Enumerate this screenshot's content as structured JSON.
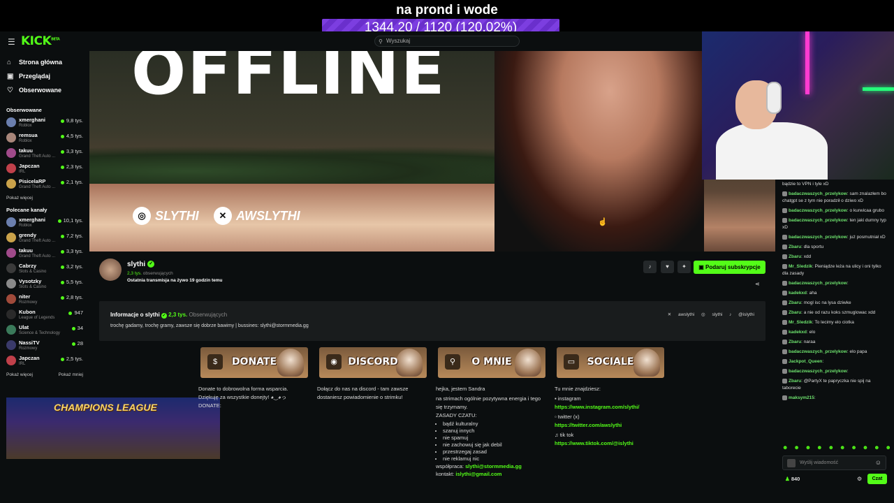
{
  "overlay": {
    "title": "na prond i wode",
    "goal": "1344.20 / 1120 (120.02%)",
    "goal_progress": 1.2002
  },
  "header": {
    "logo": "KICK",
    "logo_beta": "BETA",
    "search_placeholder": "Wyszukaj"
  },
  "nav": [
    {
      "label": "Strona główna",
      "icon": "home-icon",
      "glyph": "⌂"
    },
    {
      "label": "Przeglądaj",
      "icon": "browse-icon",
      "glyph": "▣"
    },
    {
      "label": "Obserwowane",
      "icon": "heart-icon",
      "glyph": "♡"
    }
  ],
  "followed": {
    "title": "Obserwowane",
    "channels": [
      {
        "name": "xmerghani",
        "category": "Roblox",
        "viewers": "9,8 tys.",
        "color": "#6b7fae"
      },
      {
        "name": "remsua",
        "category": "Roblox",
        "viewers": "4,5 tys.",
        "color": "#a8867a"
      },
      {
        "name": "takuu",
        "category": "Grand Theft Auto ...",
        "viewers": "3,3 tys.",
        "color": "#a04a8a"
      },
      {
        "name": "Japczan",
        "category": "IRL",
        "viewers": "2,3 tys.",
        "color": "#c0404a"
      },
      {
        "name": "PisicelaRP",
        "category": "Grand Theft Auto ...",
        "viewers": "2,1 tys.",
        "color": "#caa24a"
      }
    ],
    "more": "Pokaż więcej"
  },
  "recommended": {
    "title": "Polecane kanały",
    "channels": [
      {
        "name": "xmerghani",
        "category": "Roblox",
        "viewers": "10,1 tys.",
        "color": "#6b7fae"
      },
      {
        "name": "grendy",
        "category": "Grand Theft Auto ...",
        "viewers": "7,2 tys.",
        "color": "#caa24a"
      },
      {
        "name": "takuu",
        "category": "Grand Theft Auto ...",
        "viewers": "3,3 tys.",
        "color": "#a04a8a"
      },
      {
        "name": "Cabrzy",
        "category": "Slots & Casino",
        "viewers": "3,2 tys.",
        "color": "#3a3a3a"
      },
      {
        "name": "Vysotzky",
        "category": "Slots & Casino",
        "viewers": "5,5 tys.",
        "color": "#8a8a8a"
      },
      {
        "name": "niter",
        "category": "Rozmowy",
        "viewers": "2,8 tys.",
        "color": "#a04a3a"
      },
      {
        "name": "Kubon",
        "category": "League of Legends",
        "viewers": "947",
        "color": "#2a2a2a"
      },
      {
        "name": "Ulat",
        "category": "Science & Technology",
        "viewers": "34",
        "color": "#3a7a5a"
      },
      {
        "name": "NassiTV",
        "category": "Rozmowy",
        "viewers": "28",
        "color": "#3a3a6a"
      },
      {
        "name": "Japczan",
        "category": "IRL",
        "viewers": "2,5 tys.",
        "color": "#c0404a"
      }
    ],
    "more": "Pokaż więcej",
    "less": "Pokaż mniej"
  },
  "promo": {
    "title": "CHAMPIONS LEAGUE"
  },
  "banner": {
    "offline": "OFFLINE",
    "instagram": "SLYTHI",
    "twitter": "AWSLYTHI"
  },
  "channel": {
    "name": "slythi",
    "followers": "2,3 tys.",
    "followers_label": "obserwujących",
    "last_stream": "Ostatnia transmisja na żywo 19 godzin temu",
    "gift_label": "Podaruj subskrypcje"
  },
  "about": {
    "title": "Informacje o slythi",
    "followers": "2,3 tys.",
    "followers_label": "Obserwujących",
    "description": "trochę gadamy, trochę gramy, zawsze się dobrze bawimy | bussines: slythi@stormmedia.gg",
    "links": [
      "awslythi",
      "slythi",
      "@islythi"
    ]
  },
  "panels": [
    {
      "label": "DONATE",
      "glyph": "$"
    },
    {
      "label": "DISCORD",
      "glyph": "◉"
    },
    {
      "label": "O MNIE",
      "glyph": "⚲"
    },
    {
      "label": "SOCIALE",
      "glyph": "▭"
    }
  ],
  "panel_texts": {
    "donate": [
      "Donate to dobrowolna forma wsparcia.",
      "Dziękuję za wszystkie donejty! ◕‿◕っ",
      "DONATE:"
    ],
    "discord": "Dołącz do nas na discord - tam zawsze dostaniesz powiadomienie o strimku!",
    "about_intro": "hejka, jestem Sandra",
    "about_body": "na strimach ogólnie pozytywna energia i tego się trzymamy.",
    "rules_title": "ZASADY CZATU:",
    "rules": [
      "bądź kulturalny",
      "szanuj innych",
      "nie spamuj",
      "nie zachowuj się jak debil",
      "przestrzegaj zasad",
      "nie reklamuj nic"
    ],
    "collab_label": "współpraca:",
    "collab_email": "slythi@stormmedia.gg",
    "contact_label": "kontakt:",
    "contact_email": "islythi@gmail.com",
    "socials_title": "Tu mnie znajdziesz:",
    "ig_label": "instagram",
    "ig_url": "https://www.instagram.com/slythi/",
    "tw_label": "twitter (x)",
    "tw_url": "https://twitter.com/awslythi",
    "tt_label": "tik tok",
    "tt_url": "https://www.tiktok.com/@islythi"
  },
  "chat": {
    "messages": [
      {
        "user": "",
        "text": "bądzie to VPN i tyle xD"
      },
      {
        "user": "badaczwaszych_przelykow",
        "text": "sam znalazłem bo chatgpt se z tym nie poradził o dziwo xD"
      },
      {
        "user": "badaczwaszych_przelykow",
        "text": "o kurwicaa grubo"
      },
      {
        "user": "badaczwaszych_przelykow",
        "text": "ten jaki dumny typ xD"
      },
      {
        "user": "badaczwaszych_przelykow",
        "text": "już posmutniał xD"
      },
      {
        "user": "Zbaru",
        "text": "dla sportu"
      },
      {
        "user": "Zbaru",
        "text": "xdd"
      },
      {
        "user": "Mr_Sledzik",
        "text": "Pieniądze leża na ulicy i oni tylko dla zasady"
      },
      {
        "user": "badaczwaszych_przelykow",
        "text": ""
      },
      {
        "user": "kadekxd",
        "text": "aha"
      },
      {
        "user": "Zbaru",
        "text": "mogl isc na lysa dziwke"
      },
      {
        "user": "Zbaru",
        "text": "a nie od razu koks szmuglowac xdd"
      },
      {
        "user": "Mr_Sledzik",
        "text": "To lecimy elo ciotka"
      },
      {
        "user": "kadekxd",
        "text": "elo"
      },
      {
        "user": "Zbaru",
        "text": "naraa"
      },
      {
        "user": "badaczwaszych_przelykow",
        "text": "elo papa"
      },
      {
        "user": "Jackpot_Queen",
        "text": ""
      },
      {
        "user": "badaczwaszych_przelykow",
        "text": ""
      },
      {
        "user": "Zbaru",
        "text": "@PartyX te papryczka nie spij na taborecie"
      },
      {
        "user": "maksym215",
        "text": ""
      }
    ],
    "input_placeholder": "Wyślij wiadomość",
    "viewers": "840",
    "send_label": "Czat"
  },
  "colors": {
    "accent": "#53fc18",
    "goal": "#7c3ee0"
  }
}
